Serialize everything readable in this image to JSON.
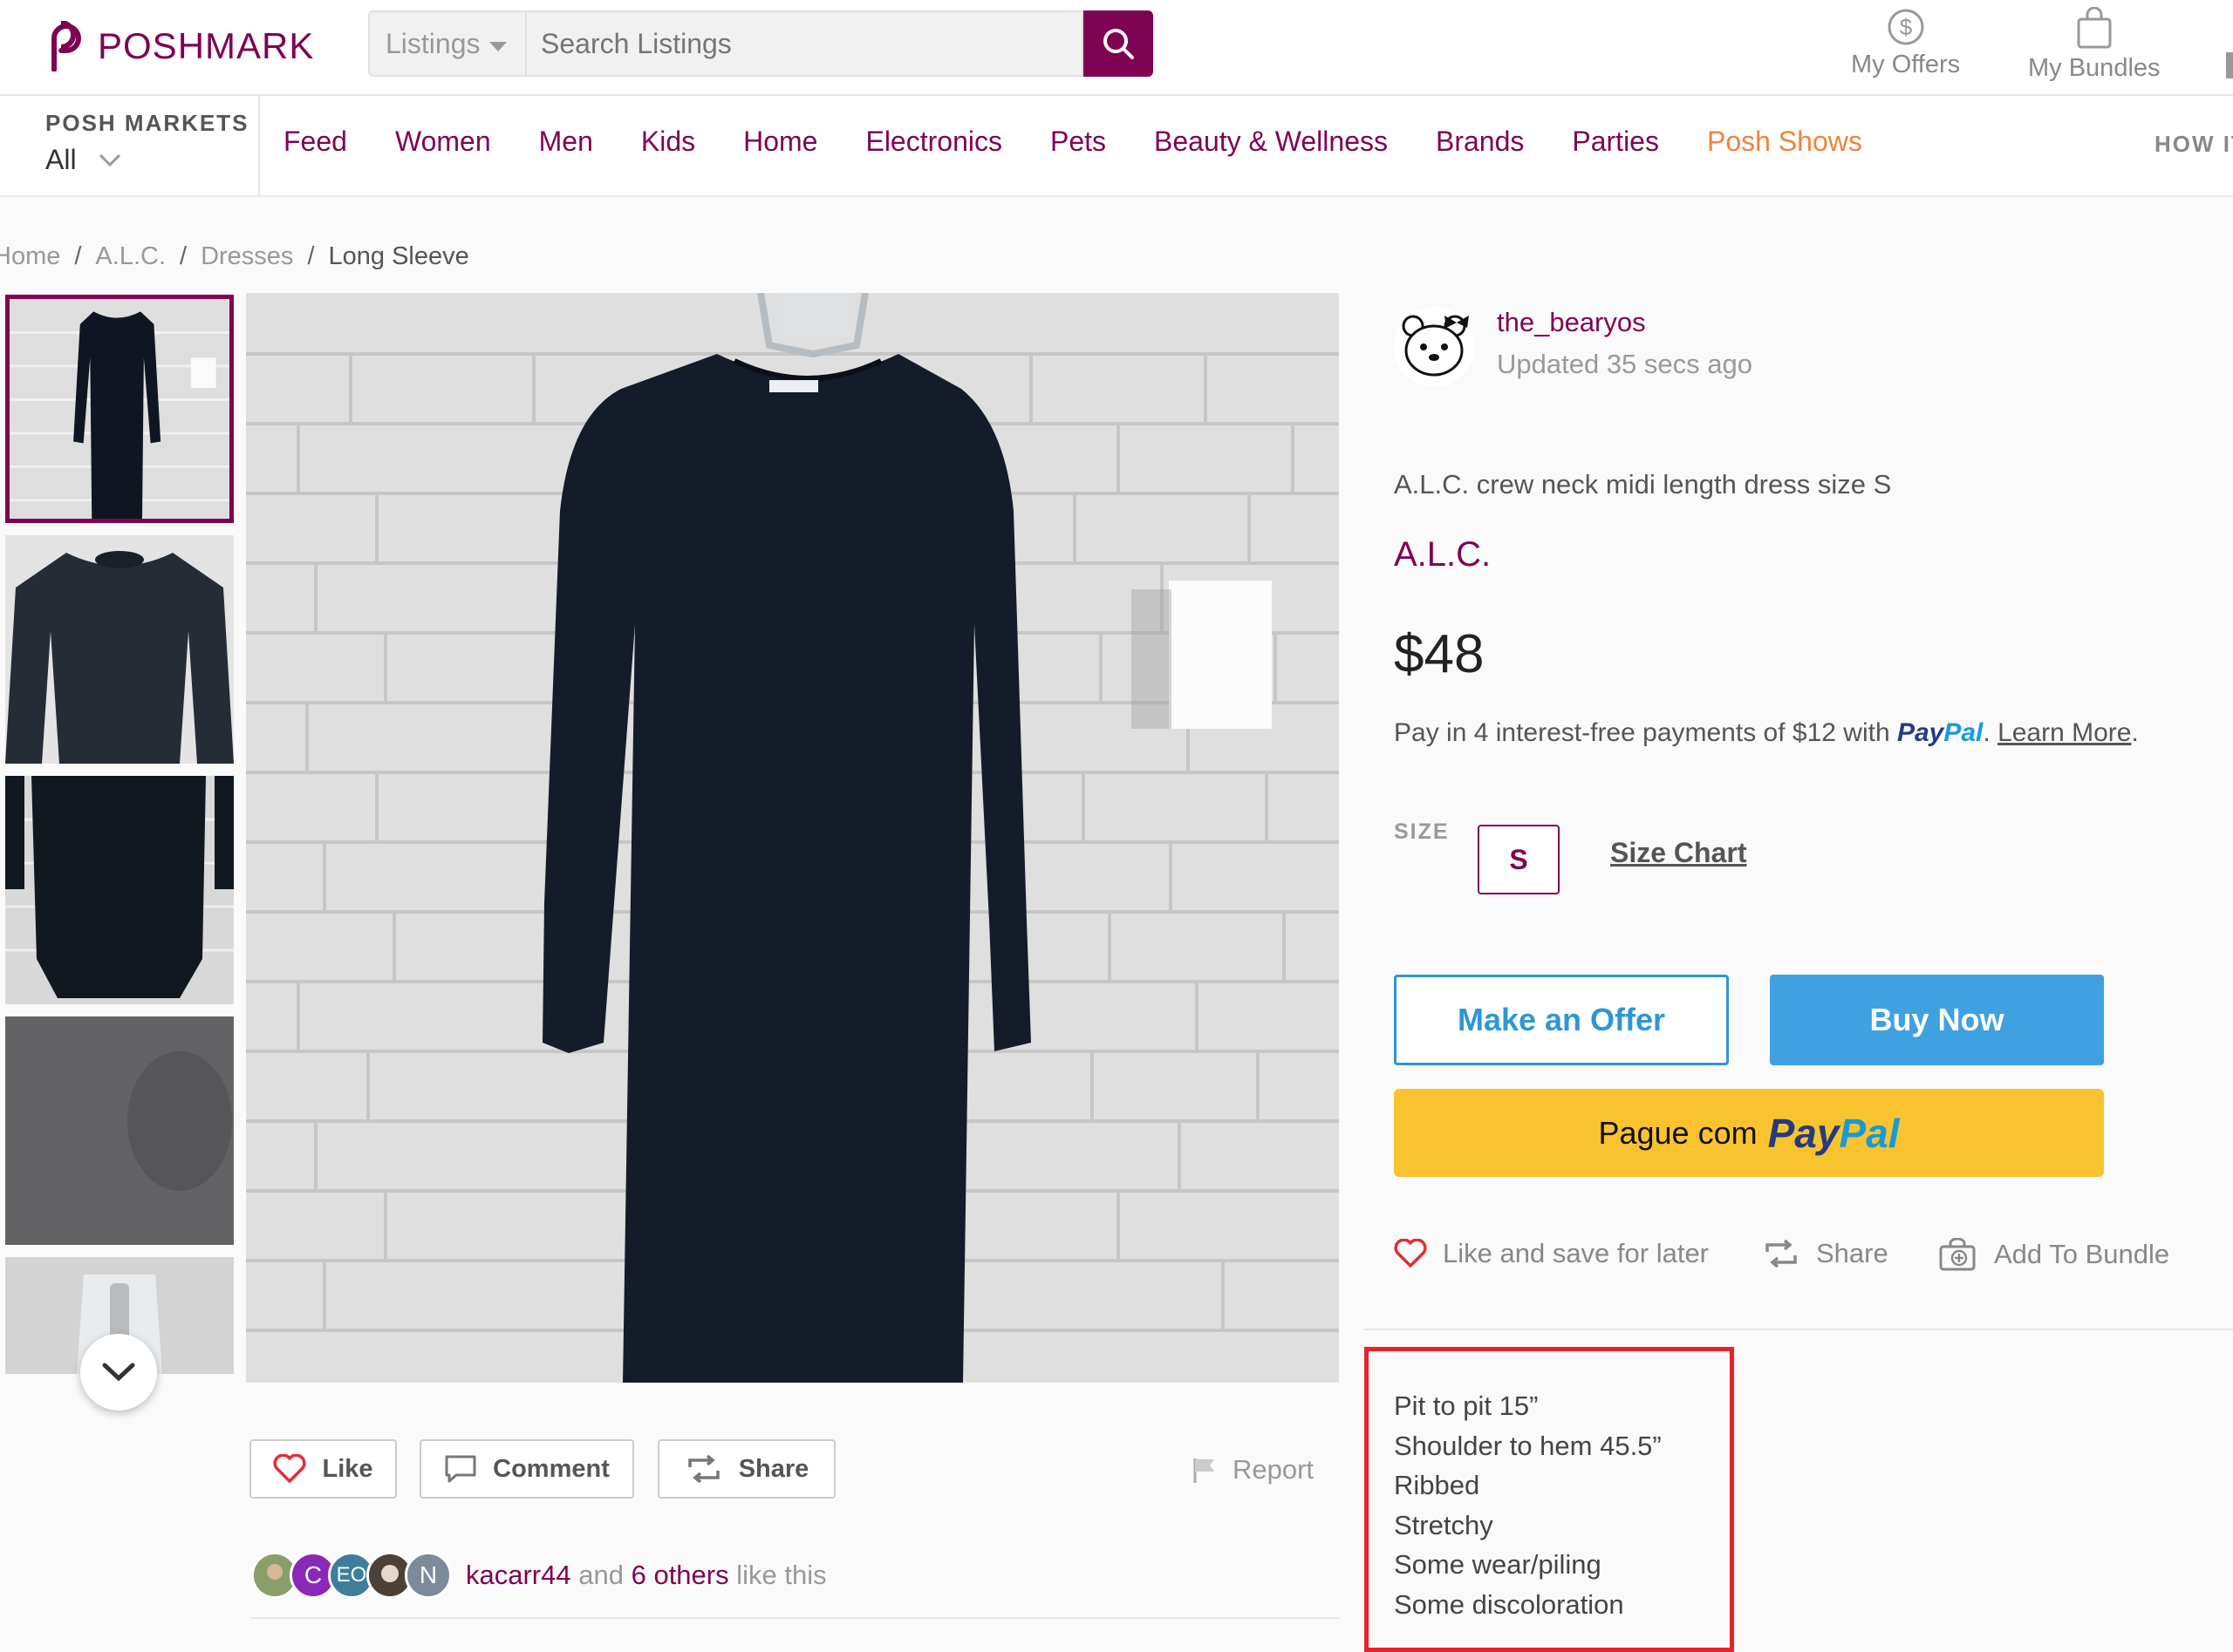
{
  "header": {
    "logo_text": "POSHMARK",
    "search_scope": "Listings",
    "search_placeholder": "Search Listings",
    "my_offers": "My Offers",
    "my_bundles": "My Bundles"
  },
  "nav": {
    "markets_label": "POSH MARKETS",
    "markets_value": "All",
    "links": [
      "Feed",
      "Women",
      "Men",
      "Kids",
      "Home",
      "Electronics",
      "Pets",
      "Beauty & Wellness",
      "Brands",
      "Parties",
      "Posh Shows"
    ],
    "how_it": "HOW IT"
  },
  "breadcrumb": [
    "Home",
    "A.L.C.",
    "Dresses",
    "Long Sleeve"
  ],
  "listing": {
    "seller": "the_bearyos",
    "updated": "Updated 35 secs ago",
    "title": "A.L.C. crew neck midi length dress size S",
    "brand": "A.L.C.",
    "price": "$48",
    "paypal_prefix": "Pay in 4 interest-free payments of $12 with",
    "paypal_pay": "Pay",
    "paypal_pal": "Pal",
    "learn_more": "Learn More",
    "size_label": "SIZE",
    "size_value": "S",
    "size_chart": "Size Chart",
    "offer_button": "Make an Offer",
    "buy_button": "Buy Now",
    "paypal_button_prefix": "Pague com",
    "like_save": "Like and save for later",
    "share": "Share",
    "add_bundle": "Add To Bundle",
    "description": [
      "Pit to pit 15”",
      "Shoulder to hem 45.5”",
      "Ribbed",
      "Stretchy",
      "Some wear/piling",
      "Some discoloration"
    ]
  },
  "image_actions": {
    "like": "Like",
    "comment": "Comment",
    "share": "Share",
    "report": "Report"
  },
  "likers": {
    "initials": [
      "C",
      "EO",
      "N"
    ],
    "user": "kacarr44",
    "and": "and",
    "others": "6 others",
    "suffix": "like this"
  },
  "colors": {
    "brand": "#7f0353",
    "buy": "#3fa1df",
    "paypal_yellow": "#f9c32f",
    "posh_shows": "#f1833b",
    "highlight_box": "#e8222b"
  }
}
